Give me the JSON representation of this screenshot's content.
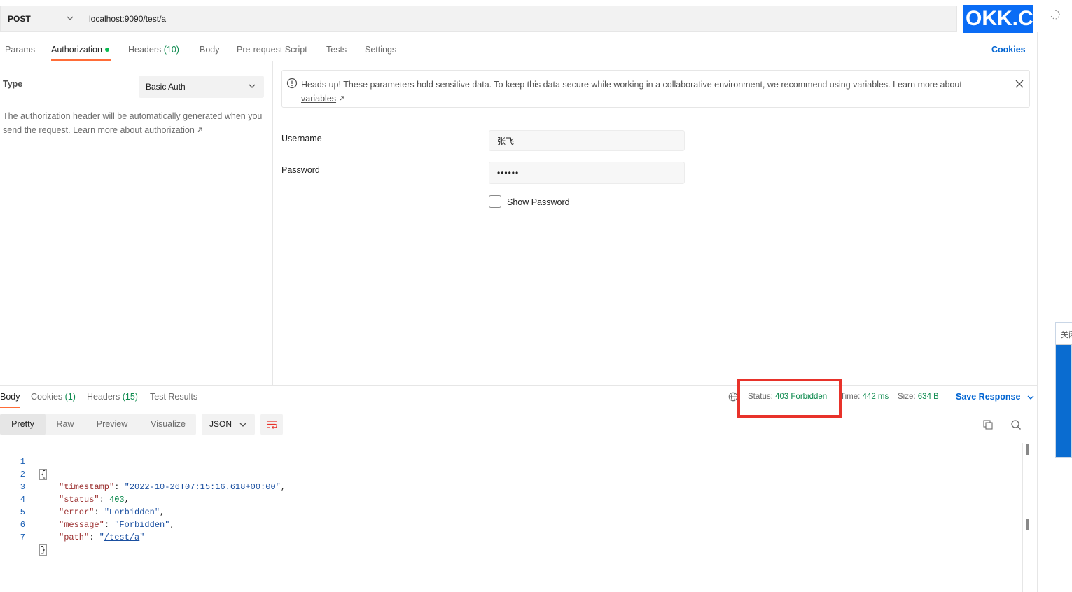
{
  "request": {
    "method": "POST",
    "url": "localhost:9090/test/a"
  },
  "logo_text": "OKK.CO",
  "request_tabs": {
    "params": "Params",
    "authorization": "Authorization",
    "headers": "Headers",
    "headers_count": "(10)",
    "body": "Body",
    "prerequest": "Pre-request Script",
    "tests": "Tests",
    "settings": "Settings",
    "cookies": "Cookies"
  },
  "auth": {
    "type_label": "Type",
    "type_value": "Basic Auth",
    "description": "The authorization header will be automatically generated when you send the request. Learn more about ",
    "description_link": "authorization",
    "banner_text": "Heads up! These parameters hold sensitive data. To keep this data secure while working in a collaborative environment, we recommend using variables. Learn more about ",
    "banner_link": "variables",
    "username_label": "Username",
    "username_value": "张飞",
    "password_label": "Password",
    "password_value": "••••••",
    "show_password_label": "Show Password"
  },
  "response_tabs": {
    "body": "Body",
    "cookies": "Cookies",
    "cookies_count": "(1)",
    "headers": "Headers",
    "headers_count": "(15)",
    "test_results": "Test Results"
  },
  "response_meta": {
    "status_label": "Status:",
    "status_value": "403 Forbidden",
    "time_label": "Time:",
    "time_value": "442 ms",
    "size_label": "Size:",
    "size_value": "634 B",
    "save_response": "Save Response"
  },
  "view": {
    "pretty": "Pretty",
    "raw": "Raw",
    "preview": "Preview",
    "visualize": "Visualize",
    "format": "JSON"
  },
  "code_lines": {
    "n1": "1",
    "n2": "2",
    "n3": "3",
    "n4": "4",
    "n5": "5",
    "n6": "6",
    "n7": "7",
    "open": "{",
    "k_timestamp": "\"timestamp\"",
    "v_timestamp": "\"2022-10-26T07:15:16.618+00:00\"",
    "k_status": "\"status\"",
    "v_status": "403",
    "k_error": "\"error\"",
    "v_error": "\"Forbidden\"",
    "k_message": "\"message\"",
    "v_message": "\"Forbidden\"",
    "k_path": "\"path\"",
    "v_path": "/test/a",
    "close": "}"
  },
  "side_widget_text": "关闭",
  "colors": {
    "accent_orange": "#ff6c37",
    "link_blue": "#0265d2",
    "status_green": "#0d8a4e",
    "highlight_red": "#e8322a"
  }
}
